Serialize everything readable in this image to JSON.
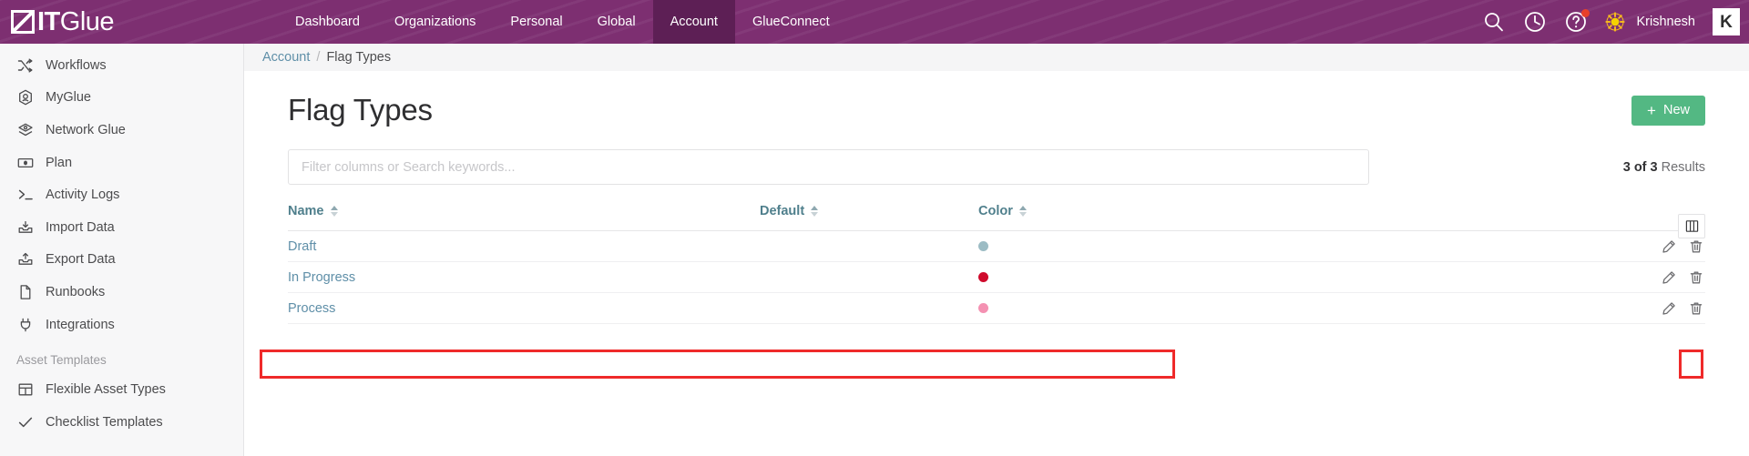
{
  "topbar": {
    "logo_text_bold": "IT",
    "logo_text_light": "Glue",
    "logo_icon": "itglue-logo-mark",
    "nav": [
      {
        "label": "Dashboard",
        "active": false
      },
      {
        "label": "Organizations",
        "active": false
      },
      {
        "label": "Personal",
        "active": false
      },
      {
        "label": "Global",
        "active": false
      },
      {
        "label": "Account",
        "active": true
      },
      {
        "label": "GlueConnect",
        "active": false
      }
    ],
    "icons": [
      {
        "name": "search-icon"
      },
      {
        "name": "recent-history-clock-icon"
      },
      {
        "name": "help-question-icon",
        "badge": true
      }
    ],
    "theme_icon": "sun-icon",
    "username": "Krishnesh",
    "app_switcher_label": "K",
    "colors": {
      "bar": "#7d2f71",
      "active_tab": "#5d1f55",
      "badge": "#e8402a",
      "sun": "#f5b820"
    }
  },
  "sidebar": {
    "items": [
      {
        "label": "Workflows",
        "icon": "shuffle-icon"
      },
      {
        "label": "MyGlue",
        "icon": "myglue-hexagon-icon"
      },
      {
        "label": "Network Glue",
        "icon": "network-glue-layers-icon"
      },
      {
        "label": "Plan",
        "icon": "banknote-icon"
      },
      {
        "label": "Activity Logs",
        "icon": "terminal-prompt-icon"
      },
      {
        "label": "Import Data",
        "icon": "import-tray-icon"
      },
      {
        "label": "Export Data",
        "icon": "export-tray-icon"
      },
      {
        "label": "Runbooks",
        "icon": "document-icon"
      },
      {
        "label": "Integrations",
        "icon": "plug-icon"
      }
    ],
    "group_label": "Asset Templates",
    "group_items": [
      {
        "label": "Flexible Asset Types",
        "icon": "grid-table-icon"
      },
      {
        "label": "Checklist Templates",
        "icon": "check-icon"
      }
    ]
  },
  "breadcrumb": {
    "parent": "Account",
    "separator": "/",
    "current": "Flag Types"
  },
  "page": {
    "title": "Flag Types",
    "new_button": {
      "label": "New",
      "plus": "+",
      "color": "#53b883"
    }
  },
  "search": {
    "value": "",
    "placeholder": "Filter columns or Search keywords..."
  },
  "results": {
    "count_text": "3 of 3",
    "suffix": "Results"
  },
  "table": {
    "columns": [
      {
        "label": "Name",
        "sortable": true
      },
      {
        "label": "Default",
        "sortable": true
      },
      {
        "label": "Color",
        "sortable": true
      }
    ],
    "column_settings_icon": "column-layout-icon",
    "rows": [
      {
        "name": "Draft",
        "default": "",
        "color": "#9cbcc4",
        "edit_icon": "pencil-edit-icon",
        "delete_icon": "trash-delete-icon",
        "highlighted": false
      },
      {
        "name": "In Progress",
        "default": "",
        "color": "#cf0a2c",
        "edit_icon": "pencil-edit-icon",
        "delete_icon": "trash-delete-icon",
        "highlighted": false
      },
      {
        "name": "Process",
        "default": "",
        "color": "#f491b2",
        "edit_icon": "pencil-edit-icon",
        "delete_icon": "trash-delete-icon",
        "highlighted": true
      }
    ]
  },
  "annotations": {
    "color": "#ef2a2a",
    "boxes": [
      {
        "name": "highlighted-row-process"
      },
      {
        "name": "highlighted-edit-button-process"
      }
    ]
  }
}
